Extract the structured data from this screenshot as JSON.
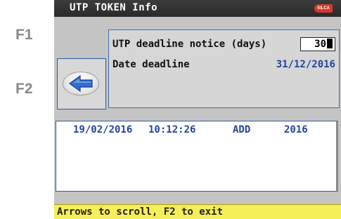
{
  "fkeys": {
    "f1": "F1",
    "f2": "F2"
  },
  "window": {
    "title": "UTP TOKEN Info",
    "logo_text": "SILCA"
  },
  "info": {
    "notice_label": "UTP deadline notice (days)",
    "notice_value": "30",
    "date_label": "Date deadline",
    "date_value": "31/12/2016"
  },
  "log": {
    "rows": [
      {
        "date": "19/02/2016",
        "time": "10:12:26",
        "action": "ADD",
        "year": "2016"
      }
    ]
  },
  "status": {
    "text": "Arrows to scroll, F2 to exit"
  },
  "colors": {
    "accent": "#23439b",
    "panel_border": "#3e6fb0",
    "status_bg": "#f5ef5a",
    "titlebar_bg": "#2a2a2a"
  },
  "icons": {
    "back": "left-arrow-icon",
    "logo": "silca-logo-icon"
  }
}
